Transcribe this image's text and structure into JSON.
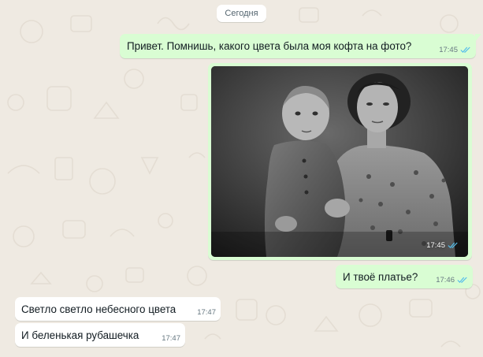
{
  "chat": {
    "date_separator": "Сегодня",
    "messages": [
      {
        "direction": "outgoing",
        "type": "text",
        "text": "Привет. Помнишь, какого цвета была моя кофта на фото?",
        "time": "17:45",
        "status": "read"
      },
      {
        "direction": "outgoing",
        "type": "photo",
        "time": "17:45",
        "status": "read"
      },
      {
        "direction": "outgoing",
        "type": "text",
        "text": "И твоё платье?",
        "time": "17:46",
        "status": "read"
      },
      {
        "direction": "incoming",
        "type": "text",
        "text": "Светло светло небесного цвета",
        "time": "17:47"
      },
      {
        "direction": "incoming",
        "type": "text",
        "text": "И беленькая рубашечка",
        "time": "17:47"
      }
    ]
  },
  "colors": {
    "background": "#efeae2",
    "outgoing_bubble": "#d9fdd3",
    "incoming_bubble": "#ffffff",
    "read_ticks": "#53bdeb",
    "timestamp": "#667781"
  },
  "icons": {
    "read_status": "double-check-icon"
  }
}
